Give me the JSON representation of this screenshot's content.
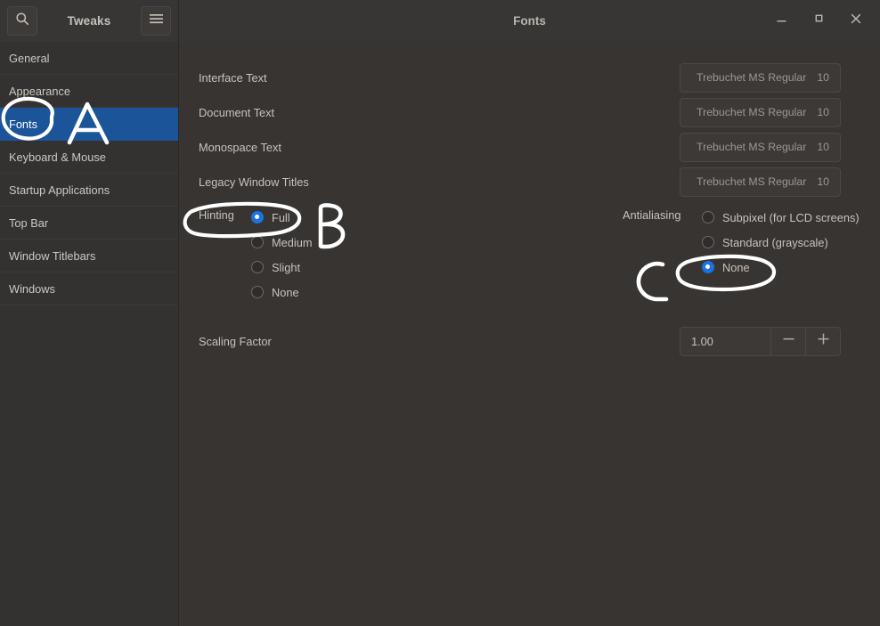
{
  "header": {
    "app_title": "Tweaks",
    "window_title": "Fonts",
    "search_icon": "search-icon",
    "menu_icon": "hamburger-menu-icon",
    "minimize_icon": "minimize-icon",
    "maximize_icon": "maximize-icon",
    "close_icon": "close-icon"
  },
  "sidebar": {
    "items": [
      {
        "label": "General",
        "selected": false
      },
      {
        "label": "Appearance",
        "selected": false
      },
      {
        "label": "Fonts",
        "selected": true
      },
      {
        "label": "Keyboard & Mouse",
        "selected": false
      },
      {
        "label": "Startup Applications",
        "selected": false
      },
      {
        "label": "Top Bar",
        "selected": false
      },
      {
        "label": "Window Titlebars",
        "selected": false
      },
      {
        "label": "Windows",
        "selected": false
      }
    ]
  },
  "main": {
    "font_rows": [
      {
        "label": "Interface Text",
        "font": "Trebuchet MS Regular",
        "size": "10"
      },
      {
        "label": "Document Text",
        "font": "Trebuchet MS Regular",
        "size": "10"
      },
      {
        "label": "Monospace Text",
        "font": "Trebuchet MS Regular",
        "size": "10"
      },
      {
        "label": "Legacy Window Titles",
        "font": "Trebuchet MS Regular",
        "size": "10"
      }
    ],
    "hinting": {
      "label": "Hinting",
      "options": [
        {
          "label": "Full",
          "selected": true
        },
        {
          "label": "Medium",
          "selected": false
        },
        {
          "label": "Slight",
          "selected": false
        },
        {
          "label": "None",
          "selected": false
        }
      ]
    },
    "antialiasing": {
      "label": "Antialiasing",
      "options": [
        {
          "label": "Subpixel (for LCD screens)",
          "selected": false
        },
        {
          "label": "Standard (grayscale)",
          "selected": false
        },
        {
          "label": "None",
          "selected": true
        }
      ]
    },
    "scaling": {
      "label": "Scaling Factor",
      "value": "1.00",
      "decrement_icon": "minus-icon",
      "increment_icon": "plus-icon"
    }
  },
  "annotations": [
    {
      "id": "a",
      "text": "A",
      "kind": "letter"
    },
    {
      "id": "b",
      "text": "B",
      "kind": "letter"
    },
    {
      "id": "c",
      "text": "C",
      "kind": "letter"
    }
  ],
  "colors": {
    "window_bg": "#373432",
    "sidebar_bg": "#343230",
    "titlebar_bg": "#383634",
    "selection_blue": "#1b5499",
    "radio_accent": "#1a73e0",
    "text_primary": "#c8c2bc",
    "text_muted": "#9d9793",
    "annotation_white": "#ffffff"
  }
}
